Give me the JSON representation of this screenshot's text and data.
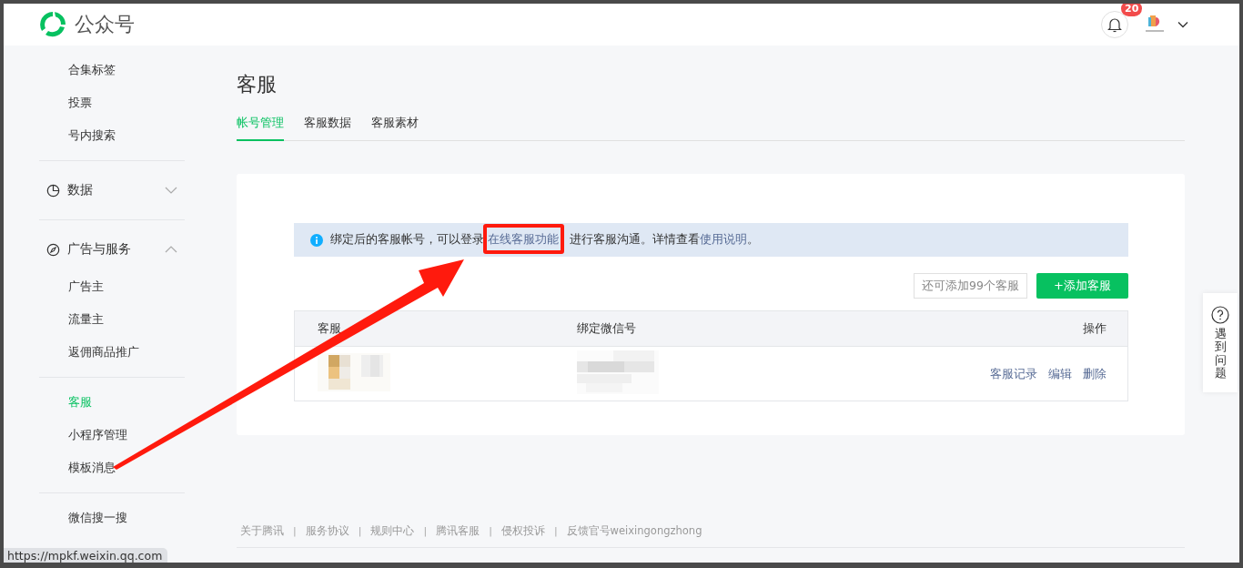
{
  "app": {
    "logo_text": "公众号"
  },
  "header": {
    "notification_count": "20"
  },
  "sidebar": {
    "sections": [
      {
        "items": [
          {
            "label": "合集标签",
            "selected": false
          },
          {
            "label": "投票",
            "selected": false
          },
          {
            "label": "号内搜索",
            "selected": false
          }
        ]
      },
      {
        "title": "数据",
        "expanded": false
      },
      {
        "title": "广告与服务",
        "expanded": true,
        "items": [
          {
            "label": "广告主",
            "selected": false
          },
          {
            "label": "流量主",
            "selected": false
          },
          {
            "label": "返佣商品推广",
            "selected": false
          }
        ]
      },
      {
        "items": [
          {
            "label": "客服",
            "selected": true
          },
          {
            "label": "小程序管理",
            "selected": false
          },
          {
            "label": "模板消息",
            "selected": false
          }
        ]
      },
      {
        "items": [
          {
            "label": "微信搜一搜",
            "selected": false
          }
        ]
      }
    ]
  },
  "page": {
    "title": "客服",
    "tabs": [
      {
        "label": "帐号管理",
        "selected": true
      },
      {
        "label": "客服数据",
        "selected": false
      },
      {
        "label": "客服素材",
        "selected": false
      }
    ]
  },
  "notice": {
    "parts": [
      {
        "text": "绑定后的客服帐号，可以登录",
        "kind": "text"
      },
      {
        "text": "在线客服功能",
        "kind": "highlighted_link"
      },
      {
        "text": "进行客服沟通。详情查看",
        "kind": "text"
      },
      {
        "text": "使用说明",
        "kind": "link"
      },
      {
        "text": "。",
        "kind": "text"
      }
    ]
  },
  "quota": "还可添加99个客服",
  "add_button": "+添加客服",
  "table": {
    "columns": [
      "客服",
      "绑定微信号",
      "操作"
    ],
    "rows": [
      {
        "info": {
          "kind": "picture"
        },
        "wechat": {
          "kind": "picture"
        },
        "actions": [
          "客服记录",
          "编辑",
          "删除"
        ]
      }
    ]
  },
  "footer": {
    "separator": "|",
    "links": [
      "关于腾讯",
      "服务协议",
      "规则中心",
      "腾讯客服",
      "侵权投诉",
      "反馈官号weixingongzhong"
    ]
  },
  "help": {
    "label": "遇到问题"
  },
  "status_url": "https://mpkf.weixin.qq.com",
  "annotations": {
    "arrow": true,
    "highlight_box": true
  }
}
